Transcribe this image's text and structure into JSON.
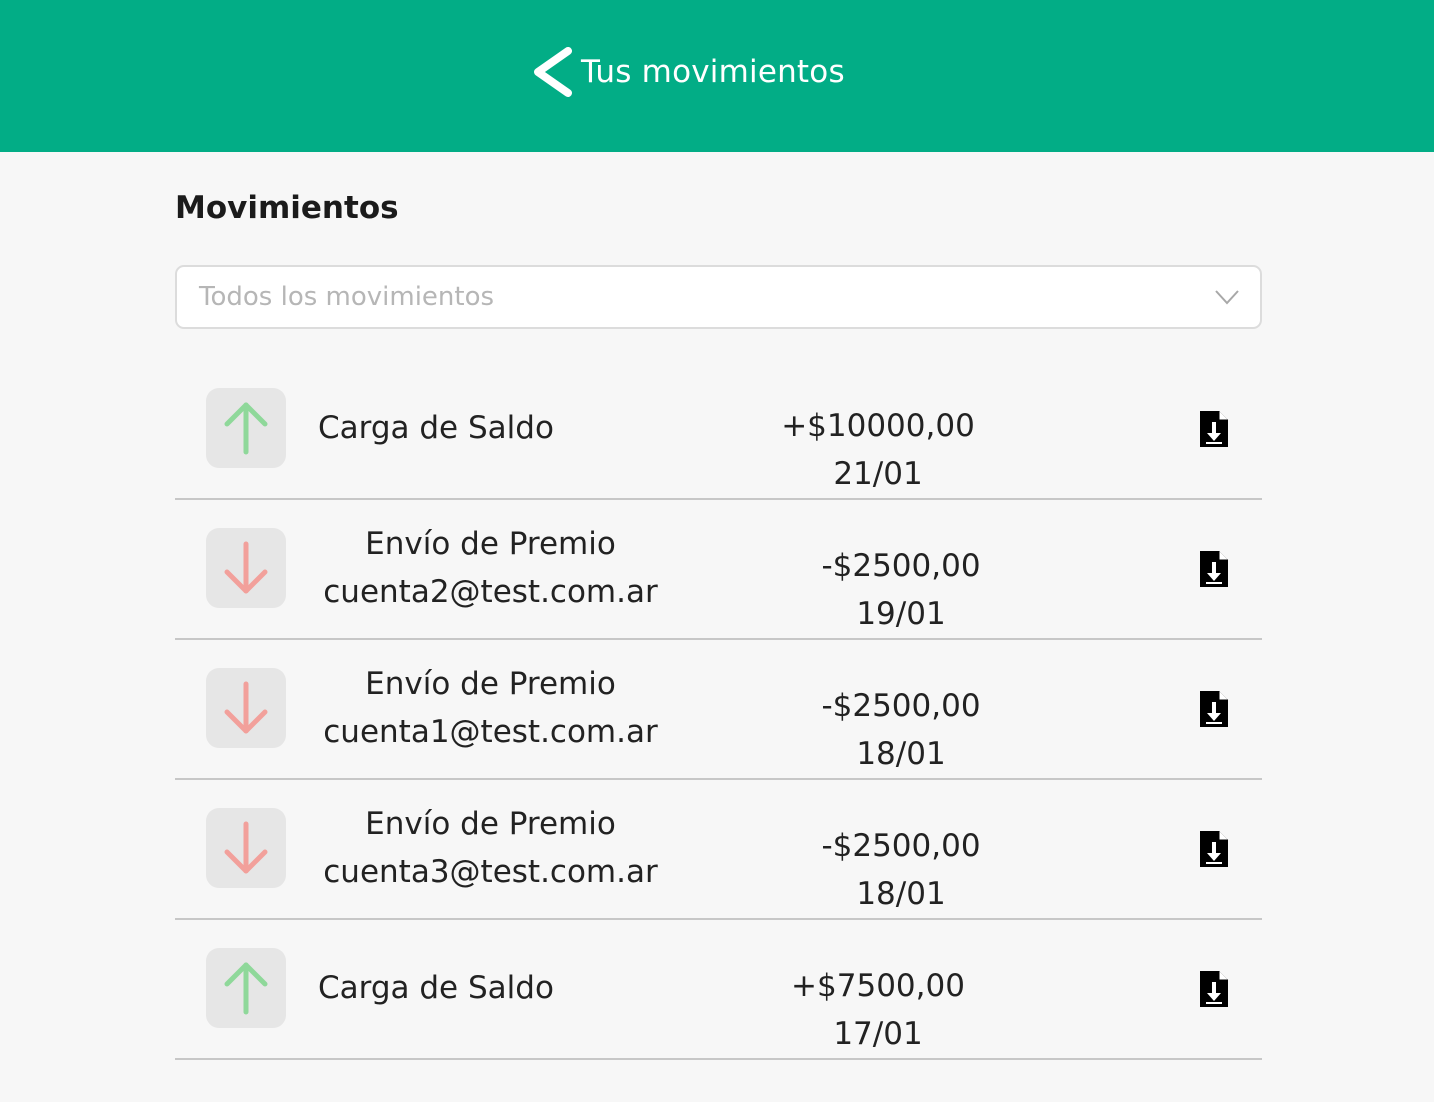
{
  "header": {
    "title": "Tus movimientos",
    "back_icon": "chevron-left-icon",
    "background": "#02ad86"
  },
  "section": {
    "title": "Movimientos"
  },
  "filter": {
    "placeholder": "Todos los movimientos",
    "icon": "chevron-down-icon"
  },
  "colors": {
    "incoming": "#8fd89a",
    "outgoing": "#f2a09b"
  },
  "movements": [
    {
      "direction": "in",
      "type": "Carga de Saldo",
      "account": "",
      "amount": "+$10000,00",
      "date": "21/01"
    },
    {
      "direction": "out",
      "type": "Envío de Premio",
      "account": "cuenta2@test.com.ar",
      "amount": "-$2500,00",
      "date": "19/01"
    },
    {
      "direction": "out",
      "type": "Envío de Premio",
      "account": "cuenta1@test.com.ar",
      "amount": "-$2500,00",
      "date": "18/01"
    },
    {
      "direction": "out",
      "type": "Envío de Premio",
      "account": "cuenta3@test.com.ar",
      "amount": "-$2500,00",
      "date": "18/01"
    },
    {
      "direction": "in",
      "type": "Carga de Saldo",
      "account": "",
      "amount": "+$7500,00",
      "date": "17/01"
    }
  ]
}
